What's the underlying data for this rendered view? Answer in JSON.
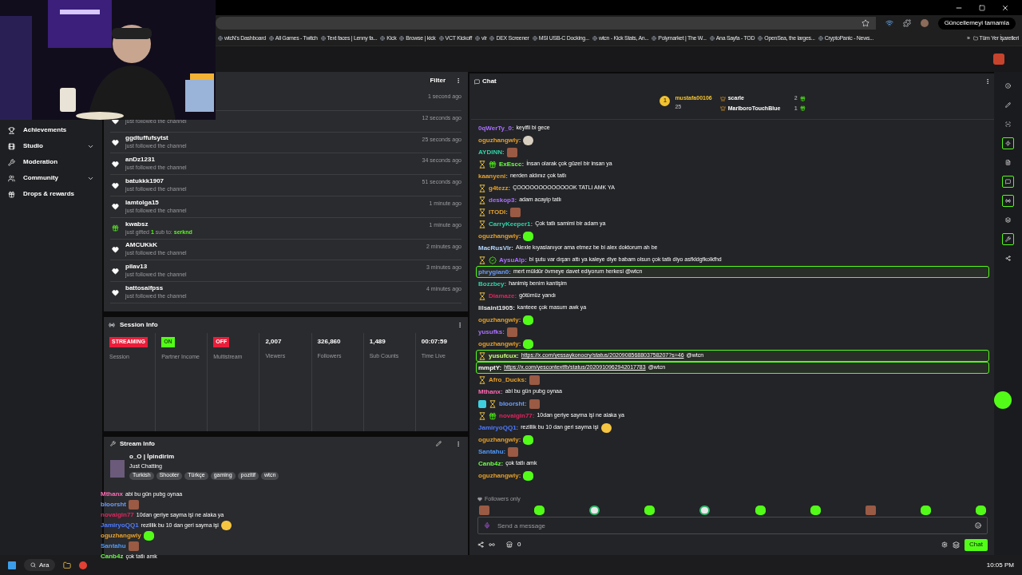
{
  "browser": {
    "update_button": "Güncellemeyi tamamla",
    "bookmarks": [
      "wtcN's Dashboard",
      "All Games - Twitch",
      "Text faces | Lenny fa...",
      "Kick",
      "Browse | kick",
      "VCT Kickoff",
      "vlr",
      "DEX Screener",
      "MSI USB-C Docking...",
      "wtcn - Kick Stats, An...",
      "Polymarket | The W...",
      "Ana Sayfa - TOD",
      "OpenSea, the larges...",
      "CryptoPanic - News..."
    ],
    "more": "»",
    "all_bookmarks": "Tüm Yer İşaretleri"
  },
  "sidebar": {
    "items": [
      {
        "label": "Achievements",
        "expandable": false
      },
      {
        "label": "Studio",
        "expandable": true
      },
      {
        "label": "Moderation",
        "expandable": false
      },
      {
        "label": "Community",
        "expandable": true
      },
      {
        "label": "Drops & rewards",
        "expandable": false
      }
    ]
  },
  "activity": {
    "filter": "Filter",
    "rows": [
      {
        "time": "1 second ago"
      },
      {
        "kind": "follow",
        "desc": "just followed the channel",
        "time": "12 seconds ago"
      },
      {
        "kind": "follow",
        "name": "ggdtuffufsytst",
        "desc": "just followed the channel",
        "time": "25 seconds ago"
      },
      {
        "kind": "follow",
        "name": "anDz1231",
        "desc": "just followed the channel",
        "time": "34 seconds ago"
      },
      {
        "kind": "follow",
        "name": "batukkk1907",
        "desc": "just followed the channel",
        "time": "51 seconds ago"
      },
      {
        "kind": "follow",
        "name": "lamtolga15",
        "desc": "just followed the channel",
        "time": "1 minute ago"
      },
      {
        "kind": "gift",
        "name": "kwabsz",
        "desc": "just gifted **1** sub to: **serknd**",
        "time": "1 minute ago"
      },
      {
        "kind": "follow",
        "name": "AMCUKkK",
        "desc": "just followed the channel",
        "time": "2 minutes ago"
      },
      {
        "kind": "follow",
        "name": "pilav13",
        "desc": "just followed the channel",
        "time": "3 minutes ago"
      },
      {
        "kind": "follow",
        "name": "battosaifpss",
        "desc": "just followed the channel",
        "time": "4 minutes ago"
      }
    ]
  },
  "session": {
    "title": "Session Info",
    "items": [
      {
        "kind": "status",
        "value": "STREAMING",
        "color": "#e91e3a",
        "label": "Session"
      },
      {
        "kind": "status",
        "value": "ON",
        "color": "#53fc18",
        "label": "Partner Income"
      },
      {
        "kind": "status",
        "value": "OFF",
        "color": "#e91e3a",
        "label": "Multistream"
      },
      {
        "kind": "stat",
        "value": "2,007",
        "label": "Viewers"
      },
      {
        "kind": "stat",
        "value": "326,860",
        "label": "Followers"
      },
      {
        "kind": "stat",
        "value": "1,489",
        "label": "Sub Counts"
      },
      {
        "kind": "stat",
        "value": "00:07:59",
        "label": "Time Live"
      }
    ]
  },
  "stream_info": {
    "title": "Stream Info",
    "stream_title": "o_O | İpindirim",
    "category": "Just Chatting",
    "tags": [
      "Turkish",
      "Shooter",
      "Türkçe",
      "gaming",
      "pozitif",
      "wtcn"
    ]
  },
  "overlay_chat": [
    {
      "user": "Mthanx",
      "color": "#ff6bb5",
      "text": "abi bu gün pubg oynaa"
    },
    {
      "user": "bloorsht",
      "color": "#6b9bff",
      "emote": {
        "kind": "face"
      }
    },
    {
      "user": "novaigin77",
      "color": "#e0245e",
      "text": "10dan geriye sayma işi ne alaka ya"
    },
    {
      "user": "JamiryoQQ1",
      "color": "#4f7bff",
      "text": "rezillik bu 10 dan geri sayma işi",
      "emote": {
        "kind": "grin"
      }
    },
    {
      "user": "oguzhangwly",
      "color": "#e6a02a",
      "emote": {
        "kind": "blob"
      }
    },
    {
      "user": "Santahu",
      "color": "#4f9bff",
      "emote": {
        "kind": "face"
      }
    },
    {
      "user": "Canb4z",
      "color": "#6bff47",
      "text": "çok tatlı amk"
    }
  ],
  "chat": {
    "title": "Chat",
    "pinned": {
      "top": {
        "rank": "1",
        "name": "mustafa00106",
        "count": "25"
      },
      "others": [
        {
          "name": "scarle",
          "count": "2"
        },
        {
          "name": "MarlboroTouchBlue",
          "count": "1"
        }
      ]
    },
    "messages": [
      {
        "user": "0qWerTy_0:",
        "color": "#a970ff",
        "text": "keyifli bi gece",
        "highlighted": false
      },
      {
        "user": "oguzhangwly:",
        "color": "#e6a02a",
        "emote": {
          "kind": "cat"
        },
        "highlighted": false
      },
      {
        "user": "AYDINN:",
        "color": "#2fd3a7",
        "emote": {
          "kind": "face"
        },
        "highlighted": false
      },
      {
        "user": "ExEscc:",
        "color": "#6bff47",
        "badges": [
          {
            "kind": "hourglass"
          },
          {
            "kind": "gift"
          }
        ],
        "text": "İnsan olarak çok güzel bir insan ya",
        "highlighted": false
      },
      {
        "user": "kaanyeni:",
        "color": "#e6a02a",
        "text": "nerden aldınız çok tatlı",
        "highlighted": false
      },
      {
        "user": "g4tezz:",
        "color": "#e6a02a",
        "badges": [
          {
            "kind": "hourglass"
          }
        ],
        "text": "ÇOOOOOOOOOOOOOK TATLI AMK YA",
        "highlighted": false
      },
      {
        "user": "deskop3:",
        "color": "#a970ff",
        "badges": [
          {
            "kind": "hourglass"
          }
        ],
        "text": "adam acayip tatlı",
        "highlighted": false
      },
      {
        "user": "ITODI:",
        "color": "#e6a02a",
        "badges": [
          {
            "kind": "hourglass"
          }
        ],
        "emote": {
          "kind": "face"
        },
        "highlighted": false
      },
      {
        "user": "CarryKeeper1:",
        "color": "#2fd3a7",
        "badges": [
          {
            "kind": "hourglass"
          }
        ],
        "text": "Çok tatlı samimi bir adam ya",
        "highlighted": false
      },
      {
        "user": "oguzhangwly:",
        "color": "#e6a02a",
        "emote": {
          "kind": "blob"
        },
        "highlighted": false
      },
      {
        "user": "MacRusVlr:",
        "color": "#b4d7ff",
        "text": "Alexle kıyaslanıyor ama etmez be bi alex doktorum ah be",
        "highlighted": false
      },
      {
        "user": "AysuAlp:",
        "color": "#a970ff",
        "badges": [
          {
            "kind": "hourglass"
          },
          {
            "kind": "verified"
          }
        ],
        "text": "bi şutu var dışarı attı ya kaleye diye babam olsun çok tatlı diyo asfkldgfkolkfhd",
        "highlighted": false
      },
      {
        "user": "phrygian0:",
        "color": "#6b9bff",
        "text": "mert müldür övmeye davet ediyorum herkesi @wtcn",
        "highlighted": true
      },
      {
        "user": "Bozzbey:",
        "color": "#2fd3a7",
        "text": "hanimiş benim kantişim",
        "highlighted": false
      },
      {
        "user": "Diamaze:",
        "color": "#e0245e",
        "badges": [
          {
            "kind": "hourglass"
          }
        ],
        "text": "götümüz yandı",
        "highlighted": false
      },
      {
        "user": "lilsaint1905:",
        "color": "#e6e6e6",
        "text": "kanteee çok masum awk ya",
        "highlighted": false
      },
      {
        "user": "oguzhangwly:",
        "color": "#e6a02a",
        "emote": {
          "kind": "blob"
        },
        "highlighted": false
      },
      {
        "user": "yusufks:",
        "color": "#a970ff",
        "emote": {
          "kind": "face"
        },
        "highlighted": false
      },
      {
        "user": "oguzhangwly:",
        "color": "#e6a02a",
        "emote": {
          "kind": "blob"
        },
        "highlighted": false
      },
      {
        "user": "yusufcux:",
        "color": "#c8ff7a",
        "badges": [
          {
            "kind": "hourglass"
          }
        ],
        "link": "https://x.com/yessaykonocry/status/2020908568803758207?s=46",
        "text": "@wtcn",
        "highlighted": true
      },
      {
        "user": "mmptY:",
        "color": "#ffffff",
        "link": "https://x.com/yescontextfb/status/2020910962942017783",
        "text": "@wtcn",
        "highlighted": true
      },
      {
        "user": "Afro_Ducks:",
        "color": "#e6a02a",
        "badges": [
          {
            "kind": "hourglass"
          }
        ],
        "emote": {
          "kind": "face"
        },
        "highlighted": false
      },
      {
        "user": "Mthanx:",
        "color": "#ff6bb5",
        "text": "abi bu gün pubg oynaa",
        "highlighted": false
      },
      {
        "user": "bloorsht:",
        "color": "#6b9bff",
        "badges": [
          {
            "kind": "og"
          },
          {
            "kind": "hourglass"
          }
        ],
        "emote": {
          "kind": "face"
        },
        "highlighted": false
      },
      {
        "user": "novaigin77:",
        "color": "#e0245e",
        "badges": [
          {
            "kind": "hourglass"
          },
          {
            "kind": "gift"
          }
        ],
        "text": "10dan geriye sayma işi ne alaka ya",
        "highlighted": false
      },
      {
        "user": "JamiryoQQ1:",
        "color": "#4f7bff",
        "text": "rezillik bu 10 dan geri sayma işi",
        "emote": {
          "kind": "grin"
        },
        "highlighted": false
      },
      {
        "user": "oguzhangwly:",
        "color": "#e6a02a",
        "emote": {
          "kind": "blob"
        },
        "highlighted": false
      },
      {
        "user": "Santahu:",
        "color": "#4f9bff",
        "emote": {
          "kind": "face"
        },
        "highlighted": false
      },
      {
        "user": "Canb4z:",
        "color": "#6bff47",
        "text": "çok tatlı amk",
        "highlighted": false
      },
      {
        "user": "oguzhangwly:",
        "color": "#e6a02a",
        "emote": {
          "kind": "blob"
        },
        "highlighted": false
      }
    ],
    "followers_only": "Followers only",
    "emote_bar": [
      {
        "kind": "face"
      },
      {
        "kind": "blob"
      },
      {
        "kind": "disc"
      },
      {
        "kind": "blob"
      },
      {
        "kind": "disc"
      },
      {
        "kind": "blob"
      },
      {
        "kind": "blob"
      },
      {
        "kind": "face"
      },
      {
        "kind": "blob"
      },
      {
        "kind": "blob"
      }
    ],
    "placeholder": "Send a message",
    "points": "0",
    "send": "Chat"
  },
  "taskbar": {
    "search": "Ara",
    "time": "10:05 PM"
  }
}
